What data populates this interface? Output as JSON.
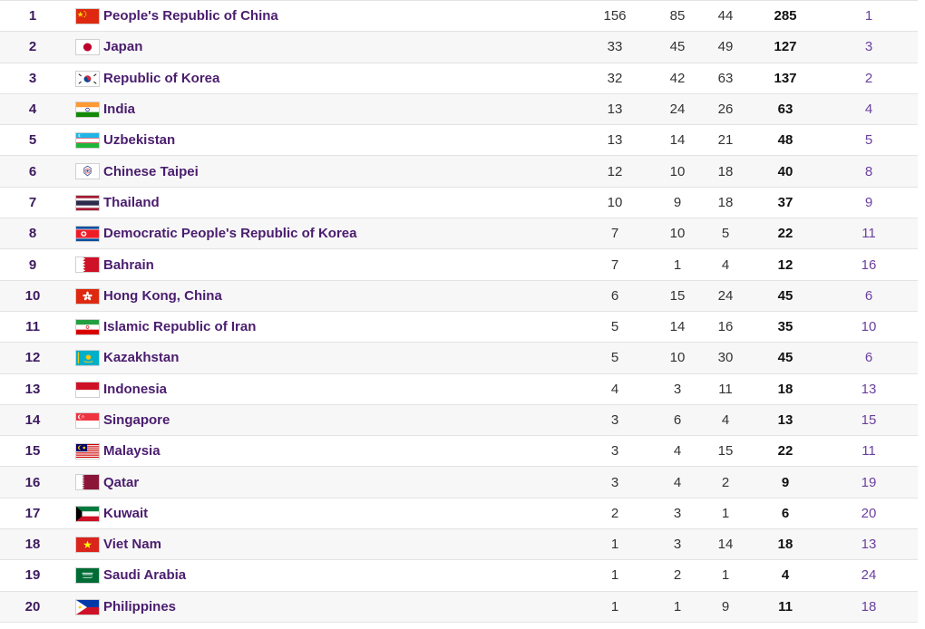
{
  "rows": [
    {
      "rank": "1",
      "country": "People's Republic of China",
      "flag": "china-flag-icon",
      "gold": "156",
      "silver": "85",
      "bronze": "44",
      "total": "285",
      "prev": "1"
    },
    {
      "rank": "2",
      "country": "Japan",
      "flag": "japan-flag-icon",
      "gold": "33",
      "silver": "45",
      "bronze": "49",
      "total": "127",
      "prev": "3"
    },
    {
      "rank": "3",
      "country": "Republic of Korea",
      "flag": "korea-flag-icon",
      "gold": "32",
      "silver": "42",
      "bronze": "63",
      "total": "137",
      "prev": "2"
    },
    {
      "rank": "4",
      "country": "India",
      "flag": "india-flag-icon",
      "gold": "13",
      "silver": "24",
      "bronze": "26",
      "total": "63",
      "prev": "4"
    },
    {
      "rank": "5",
      "country": "Uzbekistan",
      "flag": "uzbekistan-flag-icon",
      "gold": "13",
      "silver": "14",
      "bronze": "21",
      "total": "48",
      "prev": "5"
    },
    {
      "rank": "6",
      "country": "Chinese Taipei",
      "flag": "chinese-taipei-flag-icon",
      "gold": "12",
      "silver": "10",
      "bronze": "18",
      "total": "40",
      "prev": "8"
    },
    {
      "rank": "7",
      "country": "Thailand",
      "flag": "thailand-flag-icon",
      "gold": "10",
      "silver": "9",
      "bronze": "18",
      "total": "37",
      "prev": "9"
    },
    {
      "rank": "8",
      "country": "Democratic People's Republic of Korea",
      "flag": "dpr-korea-flag-icon",
      "gold": "7",
      "silver": "10",
      "bronze": "5",
      "total": "22",
      "prev": "11"
    },
    {
      "rank": "9",
      "country": "Bahrain",
      "flag": "bahrain-flag-icon",
      "gold": "7",
      "silver": "1",
      "bronze": "4",
      "total": "12",
      "prev": "16"
    },
    {
      "rank": "10",
      "country": "Hong Kong, China",
      "flag": "hong-kong-flag-icon",
      "gold": "6",
      "silver": "15",
      "bronze": "24",
      "total": "45",
      "prev": "6"
    },
    {
      "rank": "11",
      "country": "Islamic Republic of Iran",
      "flag": "iran-flag-icon",
      "gold": "5",
      "silver": "14",
      "bronze": "16",
      "total": "35",
      "prev": "10"
    },
    {
      "rank": "12",
      "country": "Kazakhstan",
      "flag": "kazakhstan-flag-icon",
      "gold": "5",
      "silver": "10",
      "bronze": "30",
      "total": "45",
      "prev": "6"
    },
    {
      "rank": "13",
      "country": "Indonesia",
      "flag": "indonesia-flag-icon",
      "gold": "4",
      "silver": "3",
      "bronze": "11",
      "total": "18",
      "prev": "13"
    },
    {
      "rank": "14",
      "country": "Singapore",
      "flag": "singapore-flag-icon",
      "gold": "3",
      "silver": "6",
      "bronze": "4",
      "total": "13",
      "prev": "15"
    },
    {
      "rank": "15",
      "country": "Malaysia",
      "flag": "malaysia-flag-icon",
      "gold": "3",
      "silver": "4",
      "bronze": "15",
      "total": "22",
      "prev": "11"
    },
    {
      "rank": "16",
      "country": "Qatar",
      "flag": "qatar-flag-icon",
      "gold": "3",
      "silver": "4",
      "bronze": "2",
      "total": "9",
      "prev": "19"
    },
    {
      "rank": "17",
      "country": "Kuwait",
      "flag": "kuwait-flag-icon",
      "gold": "2",
      "silver": "3",
      "bronze": "1",
      "total": "6",
      "prev": "20"
    },
    {
      "rank": "18",
      "country": "Viet Nam",
      "flag": "viet-nam-flag-icon",
      "gold": "1",
      "silver": "3",
      "bronze": "14",
      "total": "18",
      "prev": "13"
    },
    {
      "rank": "19",
      "country": "Saudi Arabia",
      "flag": "saudi-arabia-flag-icon",
      "gold": "1",
      "silver": "2",
      "bronze": "1",
      "total": "4",
      "prev": "24"
    },
    {
      "rank": "20",
      "country": "Philippines",
      "flag": "philippines-flag-icon",
      "gold": "1",
      "silver": "1",
      "bronze": "9",
      "total": "11",
      "prev": "18"
    }
  ],
  "colors": {
    "country_link": "#4a1d6e",
    "rank": "#3d1a5e",
    "previous_rank": "#6b3fa0",
    "row_divider": "#e3e3e3"
  }
}
